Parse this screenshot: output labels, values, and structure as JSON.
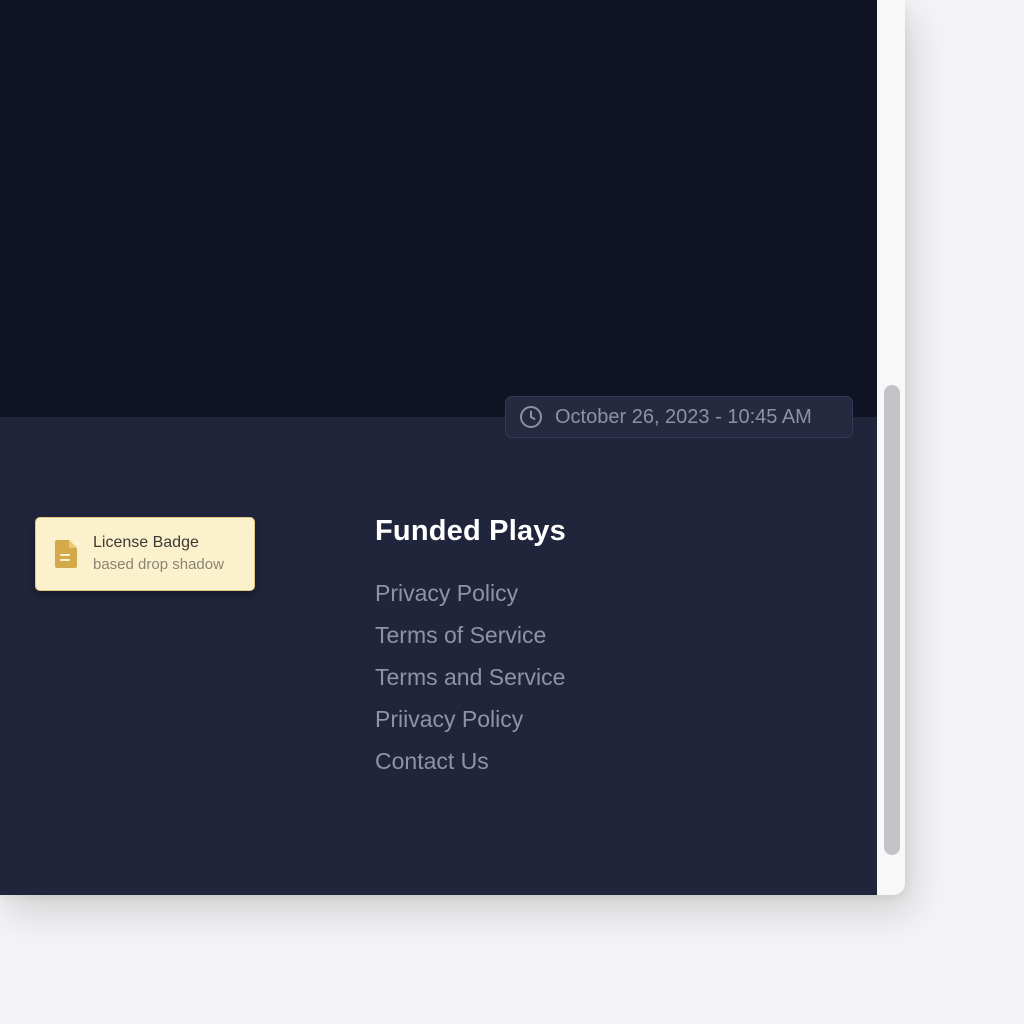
{
  "header": {
    "timestamp": "October 26, 2023 - 10:45 AM",
    "timestamp_icon": "clock-icon"
  },
  "badge": {
    "title": "License Badge",
    "subtitle": "based drop shadow",
    "icon": "document-icon",
    "accent": "#d4a94a"
  },
  "footer": {
    "heading": "Funded Plays",
    "links": [
      "Privacy Policy",
      "Terms of Service",
      "Terms and Service",
      "Priivacy Policy",
      "Contact Us"
    ]
  },
  "colors": {
    "hero_bg": "#0f1324",
    "footer_bg": "#21253c",
    "link": "#8e93a8",
    "heading": "#ffffff"
  }
}
